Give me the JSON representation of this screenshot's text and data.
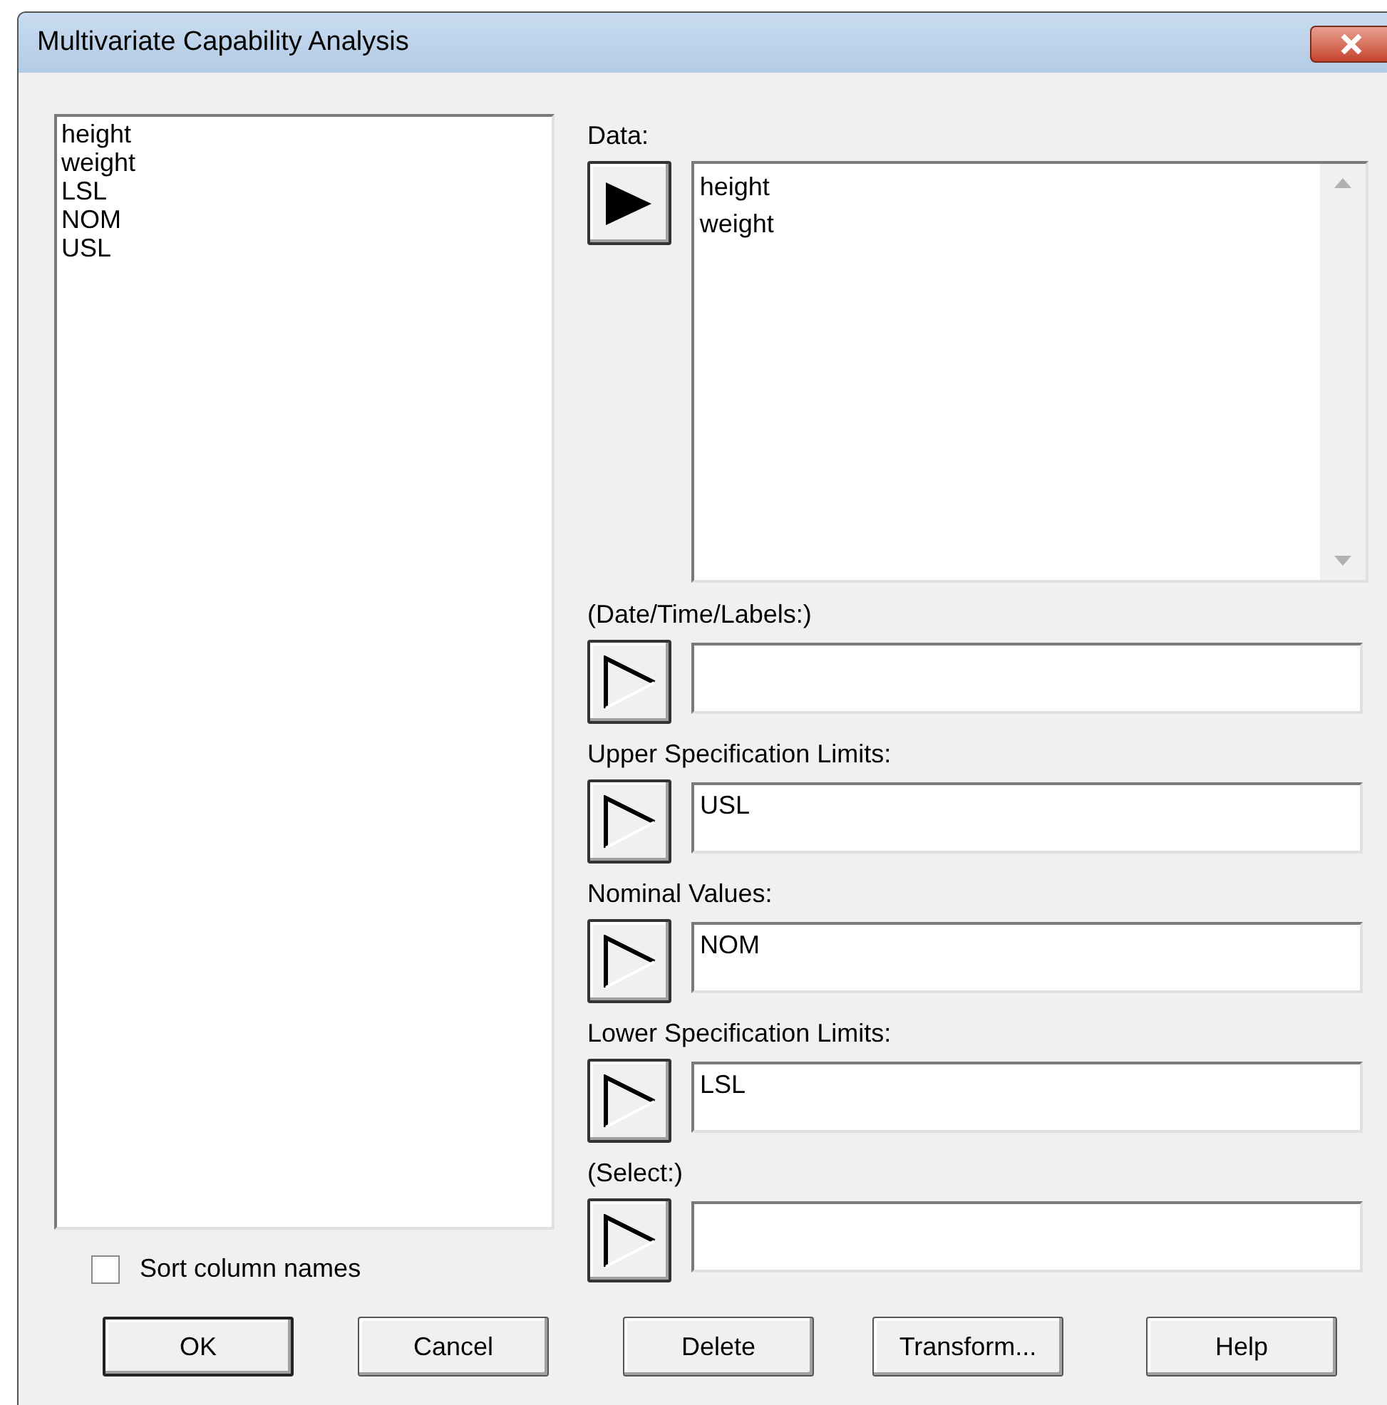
{
  "window": {
    "title": "Multivariate Capability Analysis"
  },
  "column_list": {
    "items": [
      "height",
      "weight",
      "LSL",
      "NOM",
      "USL"
    ]
  },
  "sort_checkbox": {
    "label": "Sort column names",
    "checked": false
  },
  "data": {
    "label": "Data:",
    "items": [
      "height",
      "weight"
    ]
  },
  "fields": [
    {
      "label": "(Date/Time/Labels:)"
    },
    {
      "label": "Upper Specification Limits:",
      "value": "USL"
    },
    {
      "label": "Nominal Values:",
      "value": "NOM"
    },
    {
      "label": "Lower Specification Limits:",
      "value": "LSL"
    },
    {
      "label": "(Select:)"
    }
  ],
  "buttons": [
    {
      "label": "OK",
      "default": true
    },
    {
      "label": "Cancel",
      "default": false
    },
    {
      "label": "Delete",
      "default": false
    },
    {
      "label": "Transform...",
      "default": false
    },
    {
      "label": "Help",
      "default": false
    }
  ]
}
